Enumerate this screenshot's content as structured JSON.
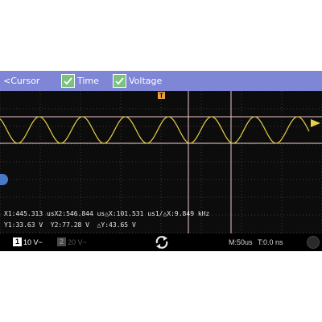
{
  "toolbar": {
    "back_label": "<Cursor",
    "time_label": "Time",
    "voltage_label": "Voltage",
    "time_checked": true,
    "voltage_checked": true
  },
  "trigger_marker": "T",
  "readout": {
    "line1": "X1:445.313 usX2:546.844 us△X:101.531 us1/△X:9.849 kHz",
    "line2": "Y1:33.63 V  Y2:77.28 V  △Y:43.65 V"
  },
  "channels": [
    {
      "number": "1",
      "setting": "10 V~",
      "active": true
    },
    {
      "number": "2",
      "setting": "20 V~",
      "active": false
    }
  ],
  "timebase": "M:50us",
  "trigger_offset": "T:0.0 ns",
  "colors": {
    "toolbar": "#7f86d6",
    "checkbox": "#7bc37c",
    "waveform": "#e8d04a",
    "cursor": "#f0c8c8",
    "screen": "#0c0c0c"
  },
  "icons": [
    "back-icon",
    "check-icon",
    "trigger-marker-icon",
    "trigger-level-arrow-icon",
    "refresh-icon",
    "run-stop-icon"
  ]
}
